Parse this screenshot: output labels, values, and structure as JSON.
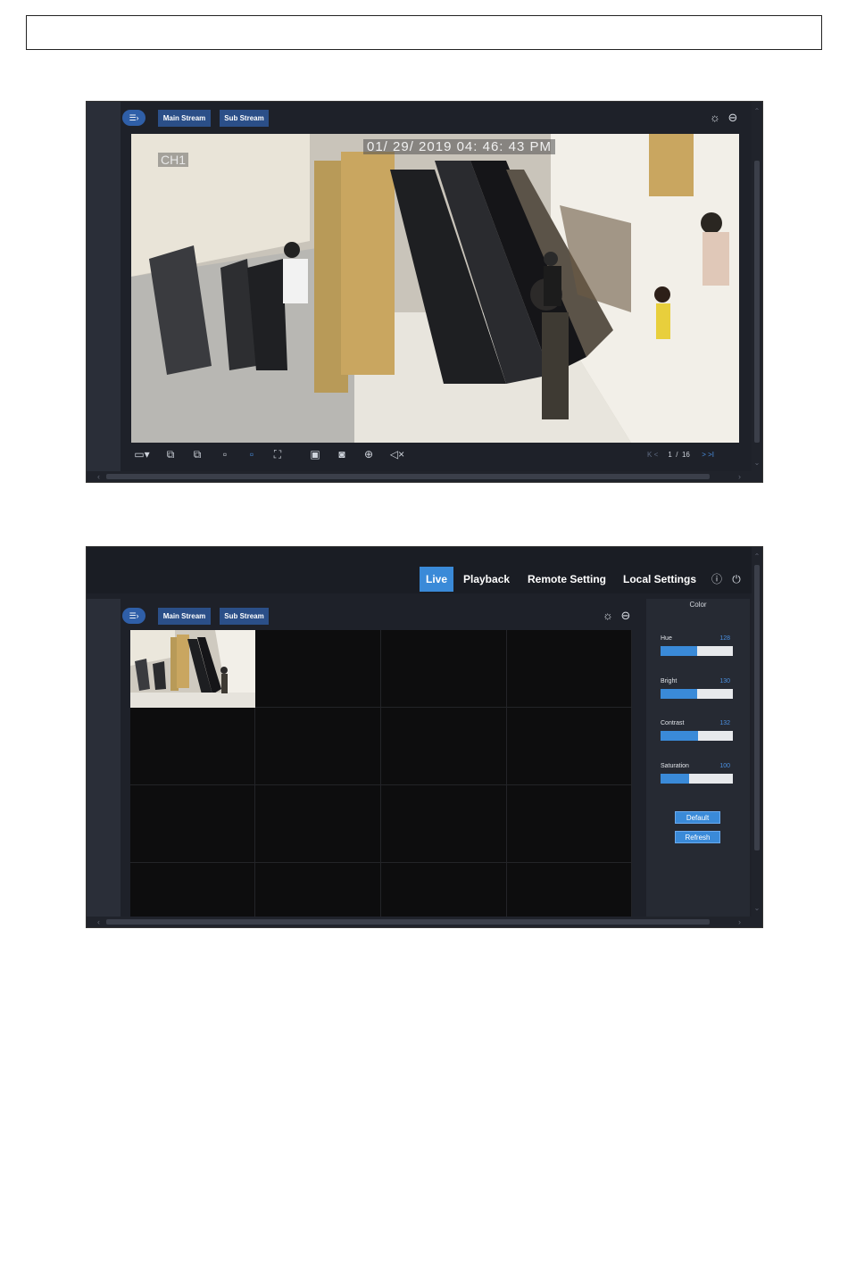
{
  "screen1": {
    "toolbar": {
      "menu_icon": "list-icon",
      "main_stream": "Main Stream",
      "sub_stream": "Sub Stream",
      "right_icons": [
        "brightness-icon",
        "ptz-dome-icon"
      ]
    },
    "video": {
      "channel": "CH1",
      "timestamp": "01/ 29/ 2019  04: 46: 43  PM"
    },
    "bottom_toolbar": {
      "icons": [
        "layout-select-icon",
        "sequence-icon",
        "split-icon",
        "window-icon",
        "window-active-icon",
        "fullscreen-icon",
        "record-icon",
        "snapshot-icon",
        "zoom-icon",
        "mute-icon"
      ],
      "pager": {
        "first": "K",
        "prev": "<",
        "current": "1",
        "separator": "/",
        "total": "16",
        "next": ">",
        "last": ">I"
      }
    }
  },
  "screen2": {
    "nav": {
      "items": [
        "Live",
        "Playback",
        "Remote Setting",
        "Local Settings"
      ],
      "active": "Live",
      "right_icons": [
        "info-icon",
        "power-icon"
      ]
    },
    "toolbar": {
      "menu_icon": "list-icon",
      "main_stream": "Main Stream",
      "sub_stream": "Sub Stream",
      "right_icons": [
        "brightness-icon",
        "ptz-dome-icon"
      ]
    },
    "grid": {
      "rows": 4,
      "cols": 4,
      "active_cells": 1
    },
    "color_panel": {
      "title": "Color",
      "sliders": [
        {
          "label": "Hue",
          "value": "128",
          "fraction": 0.5
        },
        {
          "label": "Bright",
          "value": "130",
          "fraction": 0.51
        },
        {
          "label": "Contrast",
          "value": "132",
          "fraction": 0.52
        },
        {
          "label": "Saturation",
          "value": "100",
          "fraction": 0.4
        }
      ],
      "buttons": {
        "default": "Default",
        "refresh": "Refresh"
      }
    }
  },
  "colors": {
    "accent": "#3a8ad8",
    "stream_button": "#2b4f88",
    "background": "#1e2129"
  }
}
